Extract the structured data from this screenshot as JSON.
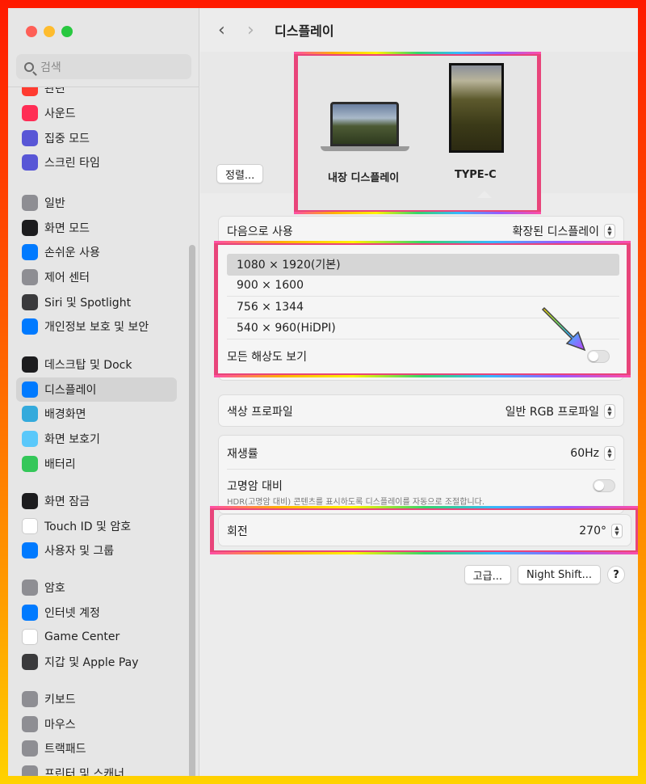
{
  "search": {
    "placeholder": "검색"
  },
  "sidebar": {
    "partial_item": "관련",
    "groups": [
      [
        {
          "label": "사운드",
          "icon": "speaker-icon",
          "color": "#ff2d55"
        },
        {
          "label": "집중 모드",
          "icon": "moon-icon",
          "color": "#5856d6"
        },
        {
          "label": "스크린 타임",
          "icon": "hourglass-icon",
          "color": "#5856d6"
        }
      ],
      [
        {
          "label": "일반",
          "icon": "gear-icon",
          "color": "#8e8e93"
        },
        {
          "label": "화면 모드",
          "icon": "appearance-icon",
          "color": "#1c1c1e"
        },
        {
          "label": "손쉬운 사용",
          "icon": "accessibility-icon",
          "color": "#007aff"
        },
        {
          "label": "제어 센터",
          "icon": "control-center-icon",
          "color": "#8e8e93"
        },
        {
          "label": "Siri 및 Spotlight",
          "icon": "siri-icon",
          "color": "#3a3a3c"
        },
        {
          "label": "개인정보 보호 및 보안",
          "icon": "hand-icon",
          "color": "#007aff"
        }
      ],
      [
        {
          "label": "데스크탑 및 Dock",
          "icon": "dock-icon",
          "color": "#1c1c1e"
        },
        {
          "label": "디스플레이",
          "icon": "sun-icon",
          "color": "#007aff",
          "active": true
        },
        {
          "label": "배경화면",
          "icon": "flower-icon",
          "color": "#34aadc"
        },
        {
          "label": "화면 보호기",
          "icon": "screensaver-icon",
          "color": "#5ac8fa"
        },
        {
          "label": "배터리",
          "icon": "battery-icon",
          "color": "#34c759"
        }
      ],
      [
        {
          "label": "화면 잠금",
          "icon": "lock-icon",
          "color": "#1c1c1e"
        },
        {
          "label": "Touch ID 및 암호",
          "icon": "fingerprint-icon",
          "color": "#ffffff"
        },
        {
          "label": "사용자 및 그룹",
          "icon": "users-icon",
          "color": "#007aff"
        }
      ],
      [
        {
          "label": "암호",
          "icon": "key-icon",
          "color": "#8e8e93"
        },
        {
          "label": "인터넷 계정",
          "icon": "at-icon",
          "color": "#007aff"
        },
        {
          "label": "Game Center",
          "icon": "game-center-icon",
          "color": "#ffffff"
        },
        {
          "label": "지갑 및 Apple Pay",
          "icon": "wallet-icon",
          "color": "#3a3a3c"
        }
      ],
      [
        {
          "label": "키보드",
          "icon": "keyboard-icon",
          "color": "#8e8e93"
        },
        {
          "label": "마우스",
          "icon": "mouse-icon",
          "color": "#8e8e93"
        },
        {
          "label": "트랙패드",
          "icon": "trackpad-icon",
          "color": "#8e8e93"
        },
        {
          "label": "프린터 및 스캐너",
          "icon": "printer-icon",
          "color": "#8e8e93"
        }
      ]
    ]
  },
  "header": {
    "title": "디스플레이",
    "back": "‹",
    "forward": "›"
  },
  "arrange": {
    "button": "정렬..."
  },
  "displays": {
    "builtin": "내장 디스플레이",
    "external": "TYPE-C"
  },
  "use_as": {
    "label": "다음으로 사용",
    "value": "확장된 디스플레이"
  },
  "resolutions": {
    "items": [
      "1080 × 1920(기본)",
      "900 × 1600",
      "756 × 1344",
      "540 × 960(HiDPI)"
    ],
    "selected_index": 0,
    "show_all_label": "모든 해상도 보기",
    "show_all_on": false
  },
  "color_profile": {
    "label": "색상 프로파일",
    "value": "일반 RGB 프로파일"
  },
  "refresh": {
    "label": "재생률",
    "value": "60Hz"
  },
  "hdr": {
    "label": "고명암 대비",
    "desc": "HDR(고명암 대비) 콘텐츠를 표시하도록 디스플레이를 자동으로 조절합니다.",
    "on": false
  },
  "rotation": {
    "label": "회전",
    "value": "270°"
  },
  "footer": {
    "advanced": "고급...",
    "night_shift": "Night Shift...",
    "help": "?"
  },
  "colors": {
    "highlight": "#e8447a",
    "accent": "#007aff"
  }
}
